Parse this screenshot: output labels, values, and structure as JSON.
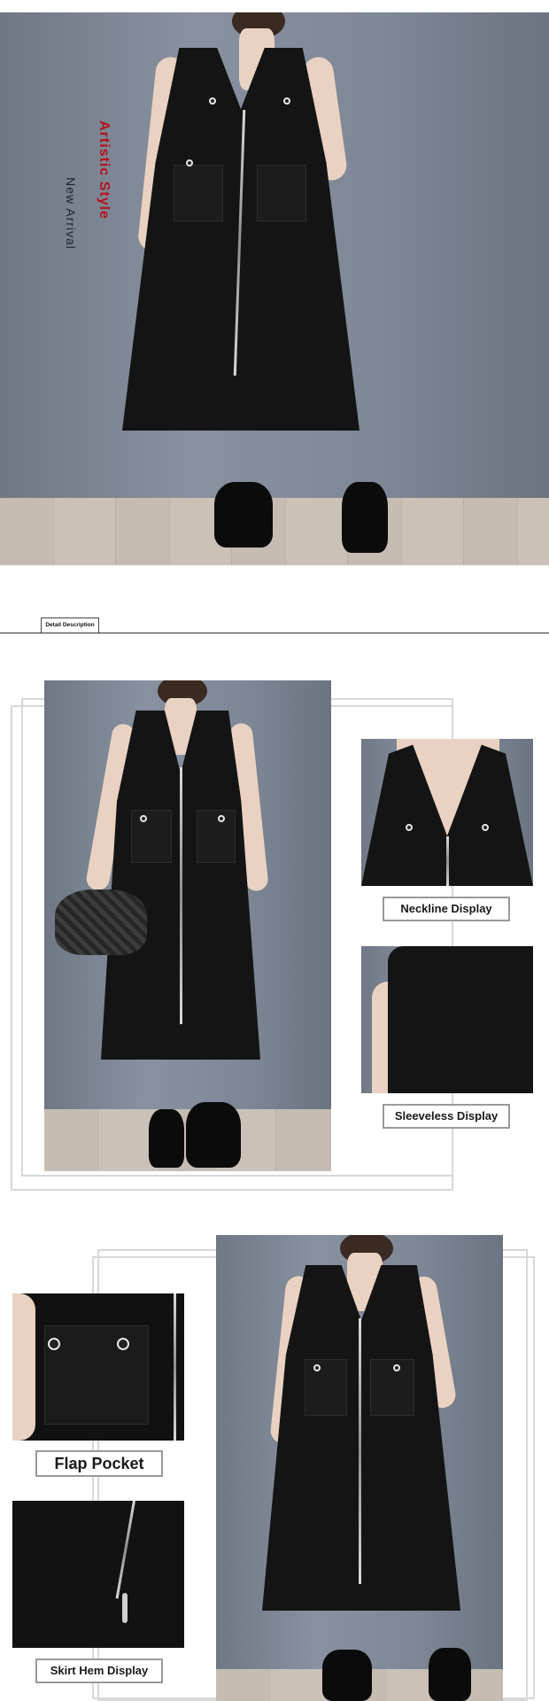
{
  "hero": {
    "style_text": "Artistic Style",
    "arrival_text": "New Arrival"
  },
  "section_tab": {
    "label": "Detail Description"
  },
  "details": {
    "neckline": "Neckline Display",
    "sleeveless": "Sleeveless Display",
    "flap_pocket": "Flap Pocket",
    "skirt_hem": "Skirt Hem Display"
  },
  "colors": {
    "accent_red": "#b5121b",
    "dress_black": "#141414",
    "backdrop_gray": "#7d8796"
  }
}
